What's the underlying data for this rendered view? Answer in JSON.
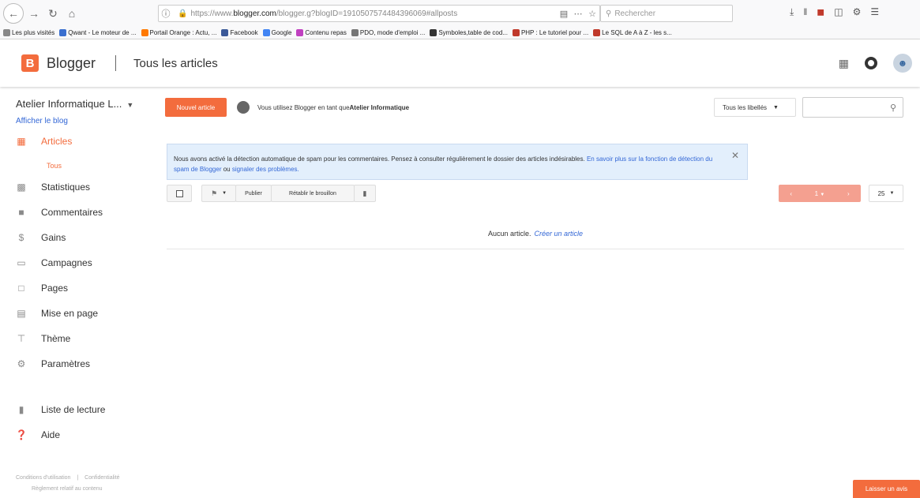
{
  "browser": {
    "url_prefix": "https://www.",
    "url_domain": "blogger.com",
    "url_rest": "/blogger.g?blogID=1910507574484396069#allposts",
    "search_placeholder": "Rechercher",
    "bookmarks": [
      {
        "label": "Les plus visités",
        "color": "#888888"
      },
      {
        "label": "Qwant - Le moteur de ...",
        "color": "#3a6fcf"
      },
      {
        "label": "Portail Orange : Actu, ...",
        "color": "#ff7900"
      },
      {
        "label": "Facebook",
        "color": "#3b5998"
      },
      {
        "label": "Google",
        "color": "#4285f4"
      },
      {
        "label": "Contenu repas",
        "color": "#c040c0"
      },
      {
        "label": "PDO, mode d'emploi ...",
        "color": "#777777"
      },
      {
        "label": "Symboles,table de cod...",
        "color": "#333333"
      },
      {
        "label": "PHP : Le tutoriel pour ...",
        "color": "#c0392b"
      },
      {
        "label": "Le SQL de A à Z - les s...",
        "color": "#c0392b"
      }
    ]
  },
  "header": {
    "logo_letter": "B",
    "brand": "Blogger",
    "page_title": "Tous les articles"
  },
  "sidebar": {
    "blog_name": "Atelier Informatique L...",
    "view_blog": "Afficher le blog",
    "items": [
      {
        "label": "Articles",
        "icon": "posts-icon",
        "active": true
      },
      {
        "label": "Statistiques",
        "icon": "stats-icon"
      },
      {
        "label": "Commentaires",
        "icon": "comments-icon"
      },
      {
        "label": "Gains",
        "icon": "dollar-icon"
      },
      {
        "label": "Campagnes",
        "icon": "campaigns-icon"
      },
      {
        "label": "Pages",
        "icon": "pages-icon"
      },
      {
        "label": "Mise en page",
        "icon": "layout-icon"
      },
      {
        "label": "Thème",
        "icon": "theme-icon"
      },
      {
        "label": "Paramètres",
        "icon": "settings-icon"
      },
      {
        "label": "Liste de lecture",
        "icon": "reading-list-icon"
      },
      {
        "label": "Aide",
        "icon": "help-icon"
      }
    ],
    "sub_item": "Tous",
    "footer": {
      "terms": "Conditions d'utilisation",
      "privacy": "Confidentialité",
      "content_policy": "Règlement relatif au contenu"
    }
  },
  "main": {
    "new_post": "Nouvel article",
    "using_prefix": "Vous utilisez Blogger en tant que ",
    "using_name": "Atelier Informatique",
    "labels_filter": "Tous les libellés",
    "notice": {
      "text": "Nous avons activé la détection automatique de spam pour les commentaires. Pensez à consulter régulièrement le dossier des articles indésirables. ",
      "link1": "En savoir plus sur la fonction de détection du spam de Blogger",
      "mid": " ou ",
      "link2": "signaler des problèmes."
    },
    "toolbar": {
      "publish": "Publier",
      "revert": "Rétablir le brouillon"
    },
    "pager": {
      "page": "1"
    },
    "per_page": "25",
    "empty_text": "Aucun article.",
    "empty_link": "Créer un article",
    "feedback": "Laisser un avis"
  },
  "colors": {
    "accent": "#f36c3d",
    "link": "#3367d6",
    "notice_bg": "#e3effc"
  }
}
